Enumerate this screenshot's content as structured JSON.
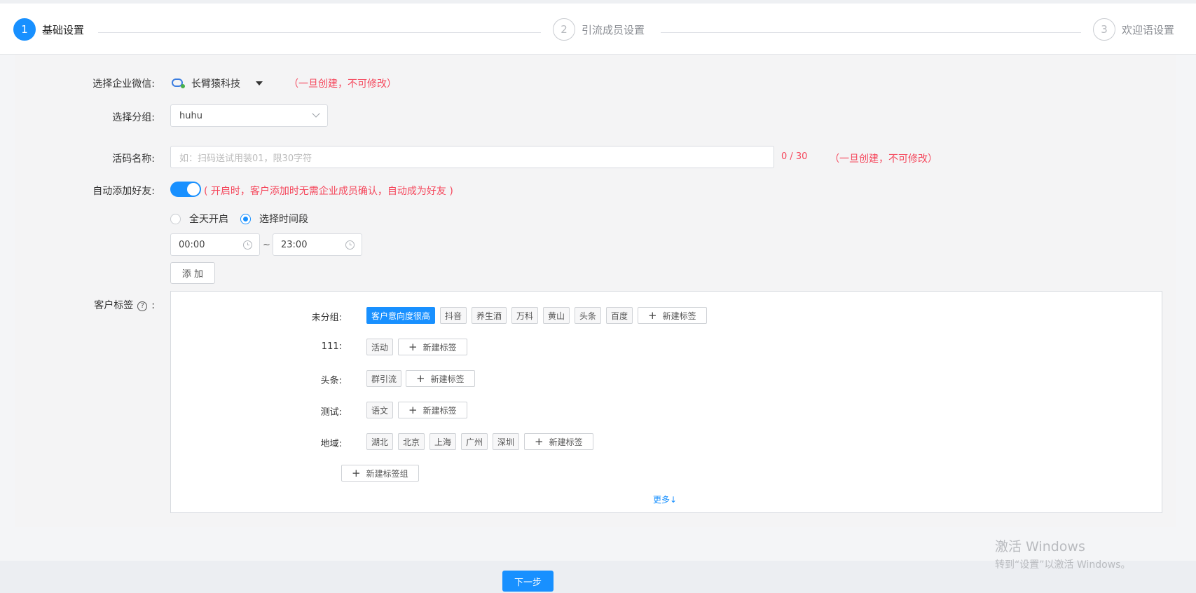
{
  "steps": [
    {
      "num": "1",
      "label": "基础设置"
    },
    {
      "num": "2",
      "label": "引流成员设置"
    },
    {
      "num": "3",
      "label": "欢迎语设置"
    }
  ],
  "form": {
    "corp_label": "选择企业微信:",
    "corp_value": "长臂猿科技",
    "corp_hint": "（一旦创建，不可修改）",
    "group_label": "选择分组:",
    "group_value": "huhu",
    "name_label": "活码名称:",
    "name_placeholder": "如：扫码送试用装01，限30字符",
    "name_counter": "0 / 30",
    "name_hint": "（一旦创建，不可修改）",
    "auto_label": "自动添加好友:",
    "auto_on": true,
    "auto_hint": "( 开启时，客户添加时无需企业成员确认，自动成为好友 )",
    "radio_all_day": "全天开启",
    "radio_period": "选择时间段",
    "time_start": "00:00",
    "time_sep": "~",
    "time_end": "23:00",
    "add_button": "添 加",
    "tags_label": "客户标签",
    "tags_help": "?",
    "tags_colon": ":"
  },
  "tag_groups": [
    {
      "name": "未分组:",
      "tags": [
        "客户意向度很高",
        "抖音",
        "养生酒",
        "万科",
        "黄山",
        "头条",
        "百度"
      ],
      "selected": "客户意向度很高"
    },
    {
      "name": "111:",
      "tags": [
        "活动"
      ]
    },
    {
      "name": "头条:",
      "tags": [
        "群引流"
      ]
    },
    {
      "name": "测试:",
      "tags": [
        "语文"
      ]
    },
    {
      "name": "地域:",
      "tags": [
        "湖北",
        "北京",
        "上海",
        "广州",
        "深圳"
      ]
    }
  ],
  "new_tag_label": "新建标签",
  "new_group_label": "新建标签组",
  "more_label": "更多↓",
  "next_button": "下一步",
  "watermark": {
    "line1": "激活 Windows",
    "line2": "转到“设置”以激活 Windows。"
  },
  "colors": {
    "accent": "#1890ff",
    "hint": "#f5475c"
  }
}
